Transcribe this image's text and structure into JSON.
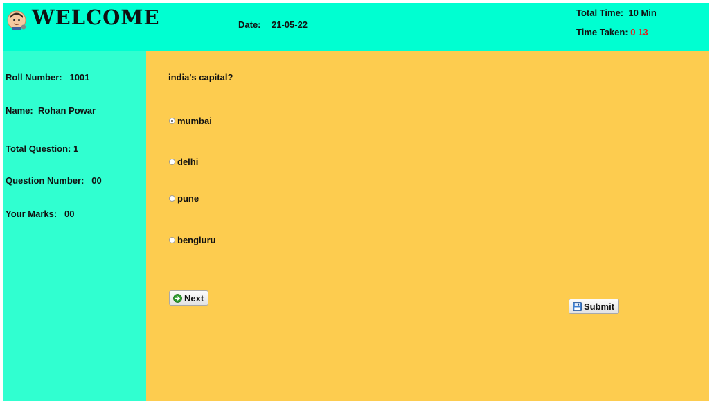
{
  "header": {
    "title": "WELCOME",
    "date_label": "Date:",
    "date_value": "21-05-22",
    "total_time_label": "Total Time:",
    "total_time_value": "10 Min",
    "time_taken_label": "Time Taken:",
    "time_taken_min": "0",
    "time_taken_sec": "13",
    "accent_red": "#e21b1b"
  },
  "sidebar": {
    "roll_label": "Roll Number:",
    "roll_value": "1001",
    "name_label": "Name:",
    "name_value": "Rohan Powar",
    "total_q_label": "Total Question:",
    "total_q_value": "1",
    "q_num_label": "Question Number:",
    "q_num_value": "00",
    "marks_label": "Your Marks:",
    "marks_value": "00",
    "bg_color": "#30ffd0"
  },
  "quiz": {
    "question": "india's capital?",
    "options": [
      {
        "label": "mumbai",
        "selected": true
      },
      {
        "label": "delhi",
        "selected": false
      },
      {
        "label": "pune",
        "selected": false
      },
      {
        "label": "bengluru",
        "selected": false
      }
    ],
    "next_label": "Next",
    "next_icon": "green-forward-circle-icon",
    "submit_label": "Submit",
    "submit_icon": "floppy-save-icon",
    "bg_color": "#fdcc4f"
  }
}
